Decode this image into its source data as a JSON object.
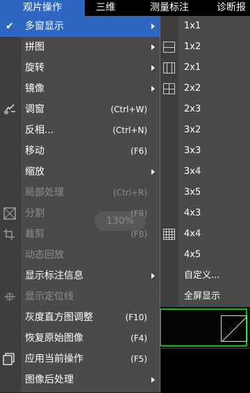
{
  "menubar": {
    "items": [
      {
        "label": "观片操作",
        "active": true
      },
      {
        "label": "三维",
        "active": false
      },
      {
        "label": "测量标注",
        "active": false
      },
      {
        "label": "诊断报",
        "active": false
      }
    ]
  },
  "menu": {
    "items": [
      {
        "label": "多窗显示",
        "shortcut": "",
        "submenu": true,
        "disabled": false,
        "selected": true,
        "icon": "check-icon"
      },
      {
        "label": "拼图",
        "shortcut": "",
        "submenu": true,
        "disabled": false,
        "selected": false,
        "icon": ""
      },
      {
        "label": "旋转",
        "shortcut": "",
        "submenu": true,
        "disabled": false,
        "selected": false,
        "icon": ""
      },
      {
        "label": "镜像",
        "shortcut": "",
        "submenu": true,
        "disabled": false,
        "selected": false,
        "icon": ""
      },
      {
        "label": "调窗",
        "shortcut": "(Ctrl+W)",
        "submenu": false,
        "disabled": false,
        "selected": false,
        "icon": "window-level-icon"
      },
      {
        "label": "反相...",
        "shortcut": "(Ctrl+N)",
        "submenu": false,
        "disabled": false,
        "selected": false,
        "icon": ""
      },
      {
        "label": "移动",
        "shortcut": "(F6)",
        "submenu": false,
        "disabled": false,
        "selected": false,
        "icon": ""
      },
      {
        "label": "缩放",
        "shortcut": "",
        "submenu": true,
        "disabled": false,
        "selected": false,
        "icon": ""
      },
      {
        "label": "局部处理",
        "shortcut": "(Ctrl+R)",
        "submenu": false,
        "disabled": true,
        "selected": false,
        "icon": ""
      },
      {
        "label": "分割",
        "shortcut": "(F8)",
        "submenu": false,
        "disabled": true,
        "selected": false,
        "icon": "split-icon"
      },
      {
        "label": "裁剪",
        "shortcut": "(F8)",
        "submenu": false,
        "disabled": true,
        "selected": false,
        "icon": "crop-icon"
      },
      {
        "label": "动态回放",
        "shortcut": "",
        "submenu": false,
        "disabled": true,
        "selected": false,
        "icon": ""
      },
      {
        "label": "显示标注信息",
        "shortcut": "",
        "submenu": true,
        "disabled": false,
        "selected": false,
        "icon": ""
      },
      {
        "label": "显示定位线",
        "shortcut": "",
        "submenu": false,
        "disabled": true,
        "selected": false,
        "icon": "locator-line-icon"
      },
      {
        "label": "灰度直方图调整",
        "shortcut": "(F10)",
        "submenu": false,
        "disabled": false,
        "selected": false,
        "icon": ""
      },
      {
        "label": "恢复原始图像",
        "shortcut": "(F4)",
        "submenu": false,
        "disabled": false,
        "selected": false,
        "icon": ""
      },
      {
        "label": "应用当前操作",
        "shortcut": "(F5)",
        "submenu": false,
        "disabled": false,
        "selected": false,
        "icon": "copy-icon"
      },
      {
        "label": "图像后处理",
        "shortcut": "",
        "submenu": true,
        "disabled": false,
        "selected": false,
        "icon": ""
      }
    ],
    "overlay_zoom": "130%"
  },
  "submenu": {
    "items": [
      {
        "label": "1x1",
        "icon": ""
      },
      {
        "label": "1x2",
        "icon": "layout-1x2-icon"
      },
      {
        "label": "2x1",
        "icon": "layout-2x1-icon"
      },
      {
        "label": "2x2",
        "icon": "layout-2x2-icon"
      },
      {
        "label": "2x3",
        "icon": ""
      },
      {
        "label": "3x2",
        "icon": ""
      },
      {
        "label": "3x3",
        "icon": ""
      },
      {
        "label": "3x4",
        "icon": ""
      },
      {
        "label": "3x5",
        "icon": ""
      },
      {
        "label": "4x3",
        "icon": ""
      },
      {
        "label": "4x4",
        "icon": "layout-4x4-icon"
      },
      {
        "label": "4x5",
        "icon": ""
      },
      {
        "label": "自定义...",
        "icon": ""
      },
      {
        "label": "全屏显示",
        "icon": ""
      }
    ]
  },
  "colors": {
    "highlight": "#2f66c1",
    "menu_bg": "#4a4a4a",
    "viewport_border": "#12b812"
  }
}
